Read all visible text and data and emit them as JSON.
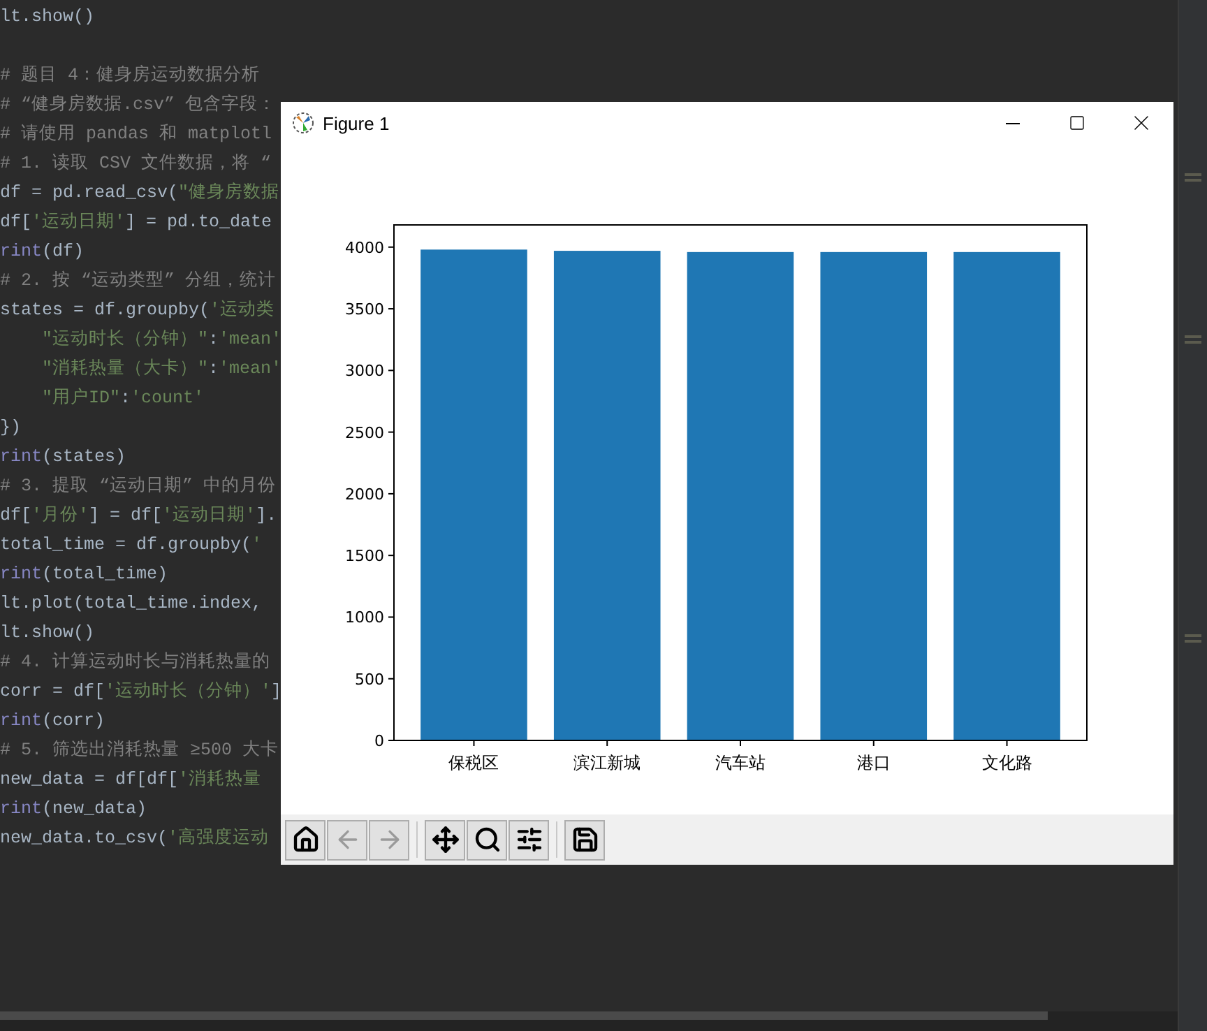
{
  "editor": {
    "lines": [
      {
        "segments": [
          {
            "text": "lt.show()",
            "kind": "plain"
          }
        ]
      },
      {
        "kind": "blank"
      },
      {
        "segments": [
          {
            "text": "# 题目 4：健身房运动数据分析",
            "kind": "comment"
          }
        ]
      },
      {
        "segments": [
          {
            "text": "# “健身房数据.csv” 包含字段：",
            "kind": "comment"
          }
        ]
      },
      {
        "segments": [
          {
            "text": "# 请使用 pandas 和 matplotl",
            "kind": "comment"
          }
        ]
      },
      {
        "segments": [
          {
            "text": "# 1. 读取 CSV 文件数据，将 “",
            "kind": "comment"
          }
        ]
      },
      {
        "segments": [
          {
            "text": "df = pd.read_csv(",
            "kind": "plain"
          },
          {
            "text": "\"健身房数据",
            "kind": "string"
          }
        ]
      },
      {
        "segments": [
          {
            "text": "df[",
            "kind": "plain"
          },
          {
            "text": "'运动日期'",
            "kind": "string"
          },
          {
            "text": "] = pd.to_date",
            "kind": "plain"
          }
        ]
      },
      {
        "segments": [
          {
            "text": "rint",
            "kind": "builtin"
          },
          {
            "text": "(df)",
            "kind": "plain"
          }
        ]
      },
      {
        "segments": [
          {
            "text": "# 2. 按 “运动类型” 分组，统计",
            "kind": "comment"
          }
        ]
      },
      {
        "segments": [
          {
            "text": "states = df.groupby(",
            "kind": "plain"
          },
          {
            "text": "'运动类",
            "kind": "string"
          }
        ]
      },
      {
        "segments": [
          {
            "text": "    \"运动时长（分钟）\"",
            "kind": "string"
          },
          {
            "text": ":",
            "kind": "plain"
          },
          {
            "text": "'mean'",
            "kind": "string"
          }
        ]
      },
      {
        "segments": [
          {
            "text": "    \"消耗热量（大卡）\"",
            "kind": "string"
          },
          {
            "text": ":",
            "kind": "plain"
          },
          {
            "text": "'mean'",
            "kind": "string"
          }
        ]
      },
      {
        "segments": [
          {
            "text": "    \"用户ID\"",
            "kind": "string"
          },
          {
            "text": ":",
            "kind": "plain"
          },
          {
            "text": "'count'",
            "kind": "string"
          }
        ]
      },
      {
        "segments": [
          {
            "text": "})",
            "kind": "plain"
          }
        ]
      },
      {
        "segments": [
          {
            "text": "rint",
            "kind": "builtin"
          },
          {
            "text": "(states)",
            "kind": "plain"
          }
        ]
      },
      {
        "segments": [
          {
            "text": "# 3. 提取 “运动日期” 中的月份",
            "kind": "comment"
          }
        ]
      },
      {
        "segments": [
          {
            "text": "df[",
            "kind": "plain"
          },
          {
            "text": "'月份'",
            "kind": "string"
          },
          {
            "text": "] = df[",
            "kind": "plain"
          },
          {
            "text": "'运动日期'",
            "kind": "string"
          },
          {
            "text": "].",
            "kind": "plain"
          }
        ]
      },
      {
        "segments": [
          {
            "text": "total_time = df.groupby(",
            "kind": "plain"
          },
          {
            "text": "'",
            "kind": "string"
          }
        ]
      },
      {
        "segments": [
          {
            "text": "rint",
            "kind": "builtin"
          },
          {
            "text": "(total_time)",
            "kind": "plain"
          }
        ]
      },
      {
        "segments": [
          {
            "text": "lt.plot(total_time.index,",
            "kind": "plain"
          }
        ]
      },
      {
        "segments": [
          {
            "text": "lt.show()",
            "kind": "plain"
          }
        ]
      },
      {
        "segments": [
          {
            "text": "# 4. 计算运动时长与消耗热量的",
            "kind": "comment"
          }
        ]
      },
      {
        "segments": [
          {
            "text": "corr = df[",
            "kind": "plain"
          },
          {
            "text": "'运动时长（分钟）'",
            "kind": "string"
          },
          {
            "text": "]",
            "kind": "plain"
          }
        ]
      },
      {
        "segments": [
          {
            "text": "rint",
            "kind": "builtin"
          },
          {
            "text": "(corr)",
            "kind": "plain"
          }
        ]
      },
      {
        "segments": [
          {
            "text": "# 5. 筛选出消耗热量 ≥500 大卡",
            "kind": "comment"
          }
        ]
      },
      {
        "segments": [
          {
            "text": "new_data = df[df[",
            "kind": "plain"
          },
          {
            "text": "'消耗热量",
            "kind": "string"
          }
        ]
      },
      {
        "segments": [
          {
            "text": "rint",
            "kind": "builtin"
          },
          {
            "text": "(new_data)",
            "kind": "plain"
          }
        ]
      },
      {
        "segments": [
          {
            "text": "new_data.to_csv(",
            "kind": "plain"
          },
          {
            "text": "'高强度运动",
            "kind": "string"
          }
        ]
      }
    ]
  },
  "figure": {
    "title": "Figure 1",
    "chart_data": {
      "type": "bar",
      "categories": [
        "保税区",
        "滨江新城",
        "汽车站",
        "港口",
        "文化路"
      ],
      "values": [
        3980,
        3970,
        3960,
        3960,
        3960
      ],
      "ylim": [
        0,
        4180
      ],
      "yticks": [
        0,
        500,
        1000,
        1500,
        2000,
        2500,
        3000,
        3500,
        4000
      ]
    },
    "toolbar": [
      {
        "kind": "home",
        "disabled": false
      },
      {
        "kind": "back",
        "disabled": true
      },
      {
        "kind": "forward",
        "disabled": true
      },
      {
        "kind": "separator"
      },
      {
        "kind": "pan",
        "disabled": false
      },
      {
        "kind": "zoom",
        "disabled": false
      },
      {
        "kind": "configure",
        "disabled": false
      },
      {
        "kind": "separator"
      },
      {
        "kind": "save",
        "disabled": false
      }
    ]
  }
}
